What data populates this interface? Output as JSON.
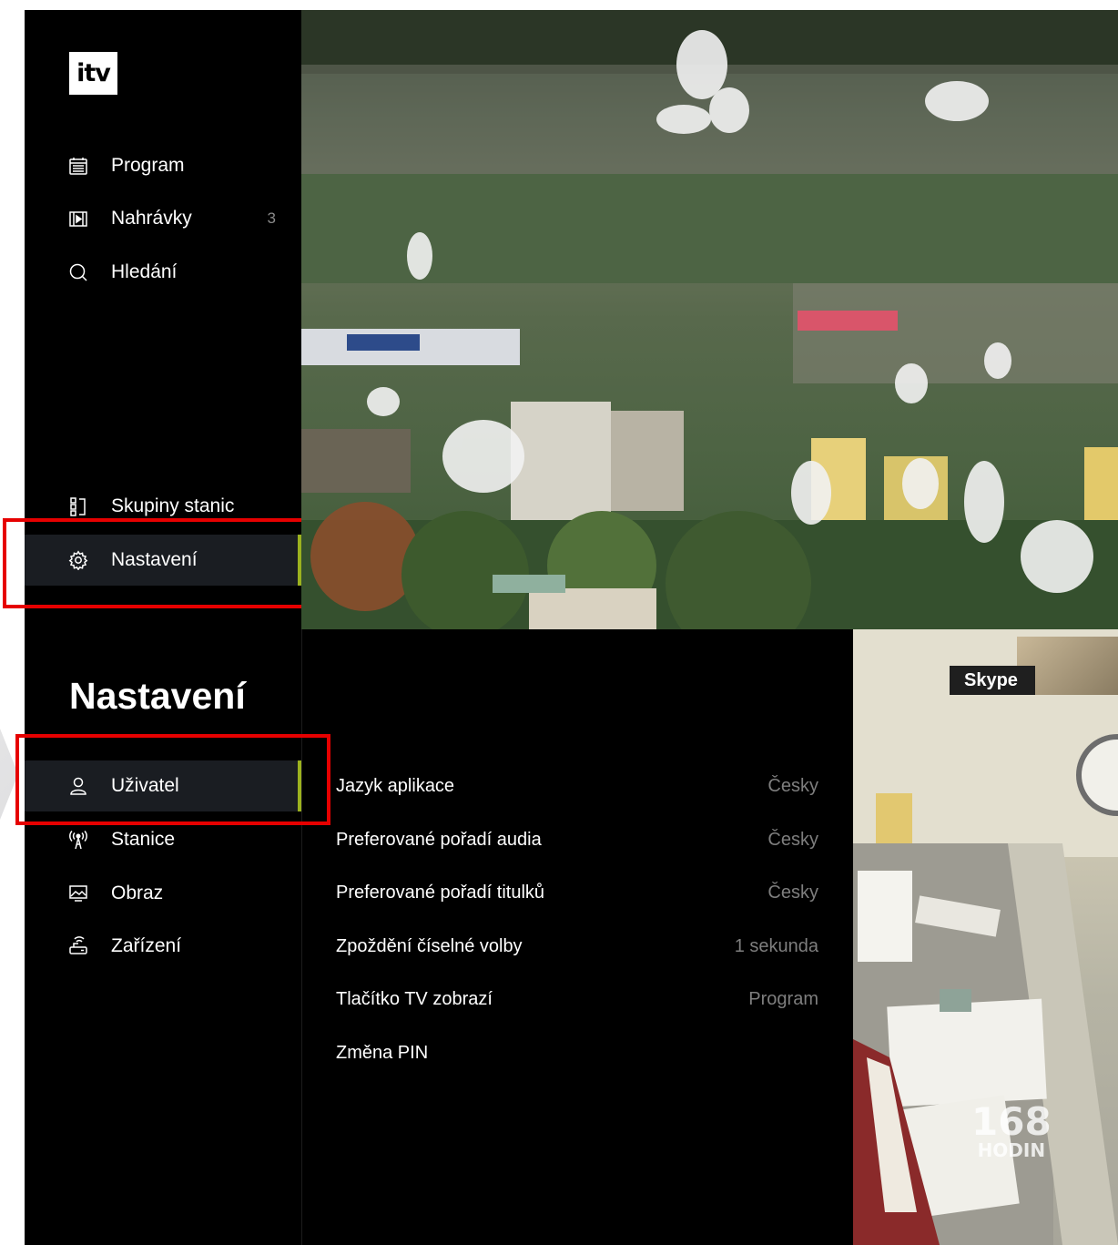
{
  "app": {
    "logo_text": "itv",
    "accent_color": "#9cb21f",
    "highlight_box_color": "#e60000"
  },
  "top_nav": {
    "items": [
      {
        "label": "Program",
        "icon": "calendar-icon"
      },
      {
        "label": "Nahrávky",
        "icon": "film-icon",
        "count": "3"
      },
      {
        "label": "Hledání",
        "icon": "search-icon"
      },
      {
        "label": "Skupiny stanic",
        "icon": "channel-groups-icon"
      },
      {
        "label": "Nastavení",
        "icon": "gear-icon",
        "active": true
      }
    ]
  },
  "settings": {
    "title": "Nastavení",
    "categories": [
      {
        "label": "Uživatel",
        "icon": "user-icon",
        "active": true
      },
      {
        "label": "Stanice",
        "icon": "antenna-icon"
      },
      {
        "label": "Obraz",
        "icon": "picture-icon"
      },
      {
        "label": "Zařízení",
        "icon": "device-icon"
      }
    ],
    "rows": [
      {
        "name": "Jazyk aplikace",
        "value": "Česky"
      },
      {
        "name": "Preferované pořadí audia",
        "value": "Česky"
      },
      {
        "name": "Preferované pořadí titulků",
        "value": "Česky"
      },
      {
        "name": "Zpoždění číselné volby",
        "value": "1 sekunda"
      },
      {
        "name": "Tlačítko TV zobrazí",
        "value": "Program"
      },
      {
        "name": "Změna PIN",
        "value": ""
      }
    ]
  },
  "skype": {
    "label": "Skype",
    "watermark_number": "168",
    "watermark_word": "HODIN"
  }
}
